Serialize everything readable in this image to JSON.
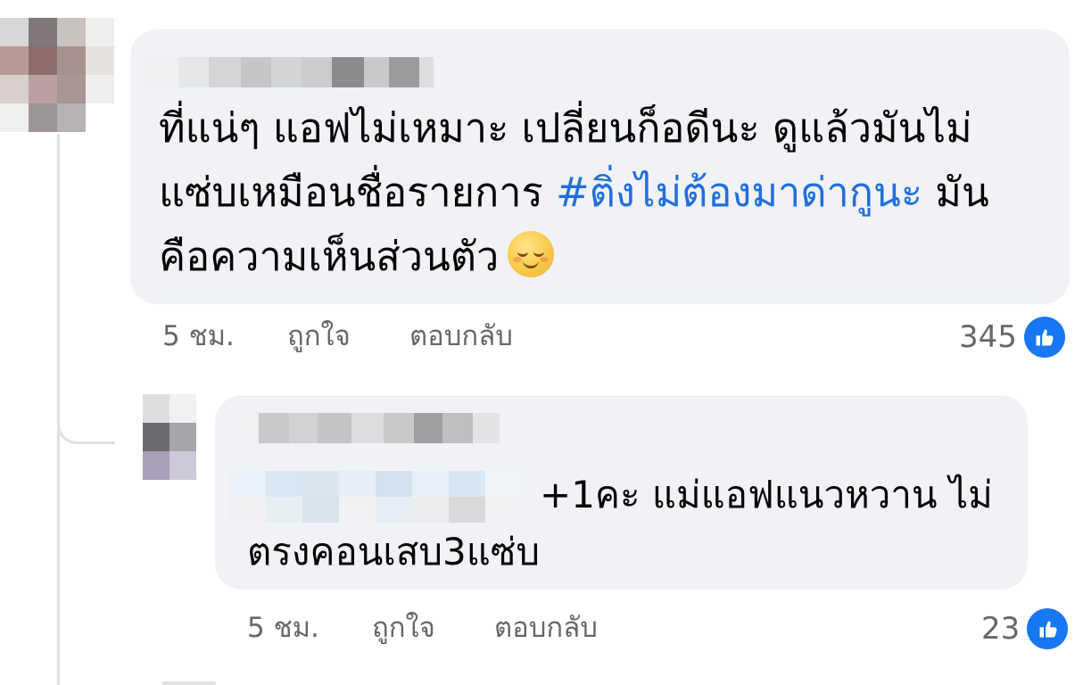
{
  "colors": {
    "bubble": "#f0f2f5",
    "text": "#050505",
    "meta": "#65676b",
    "hashtag": "#216fdb",
    "like_blue": "#1877f2"
  },
  "main_comment": {
    "text_before": "ที่แน่ๆ แอฟไม่เหมาะ  เปลี่ยนก็อดีนะ ดูแล้วมันไม่ แซ่บเหมือนชื่อรายการ ",
    "hashtag": "#ติ่งไม่ต้องมาด่ากูนะ",
    "text_after": " มันคือความเห็นส่วนตัว",
    "emoji_icon": "relieved-face-emoji",
    "time": "5 ชม.",
    "like_label": "ถูกใจ",
    "reply_label": "ตอบกลับ",
    "reaction_count": "345",
    "reaction_icon": "like-thumb-icon"
  },
  "reply_comment": {
    "text_line_1": "+1คะ แม่แอฟแนวหวาน ไม่",
    "text_line_2": "ตรงคอนเสบ3แซ่บ",
    "time": "5 ชม.",
    "like_label": "ถูกใจ",
    "reply_label": "ตอบกลับ",
    "reaction_count": "23",
    "reaction_icon": "like-thumb-icon"
  }
}
